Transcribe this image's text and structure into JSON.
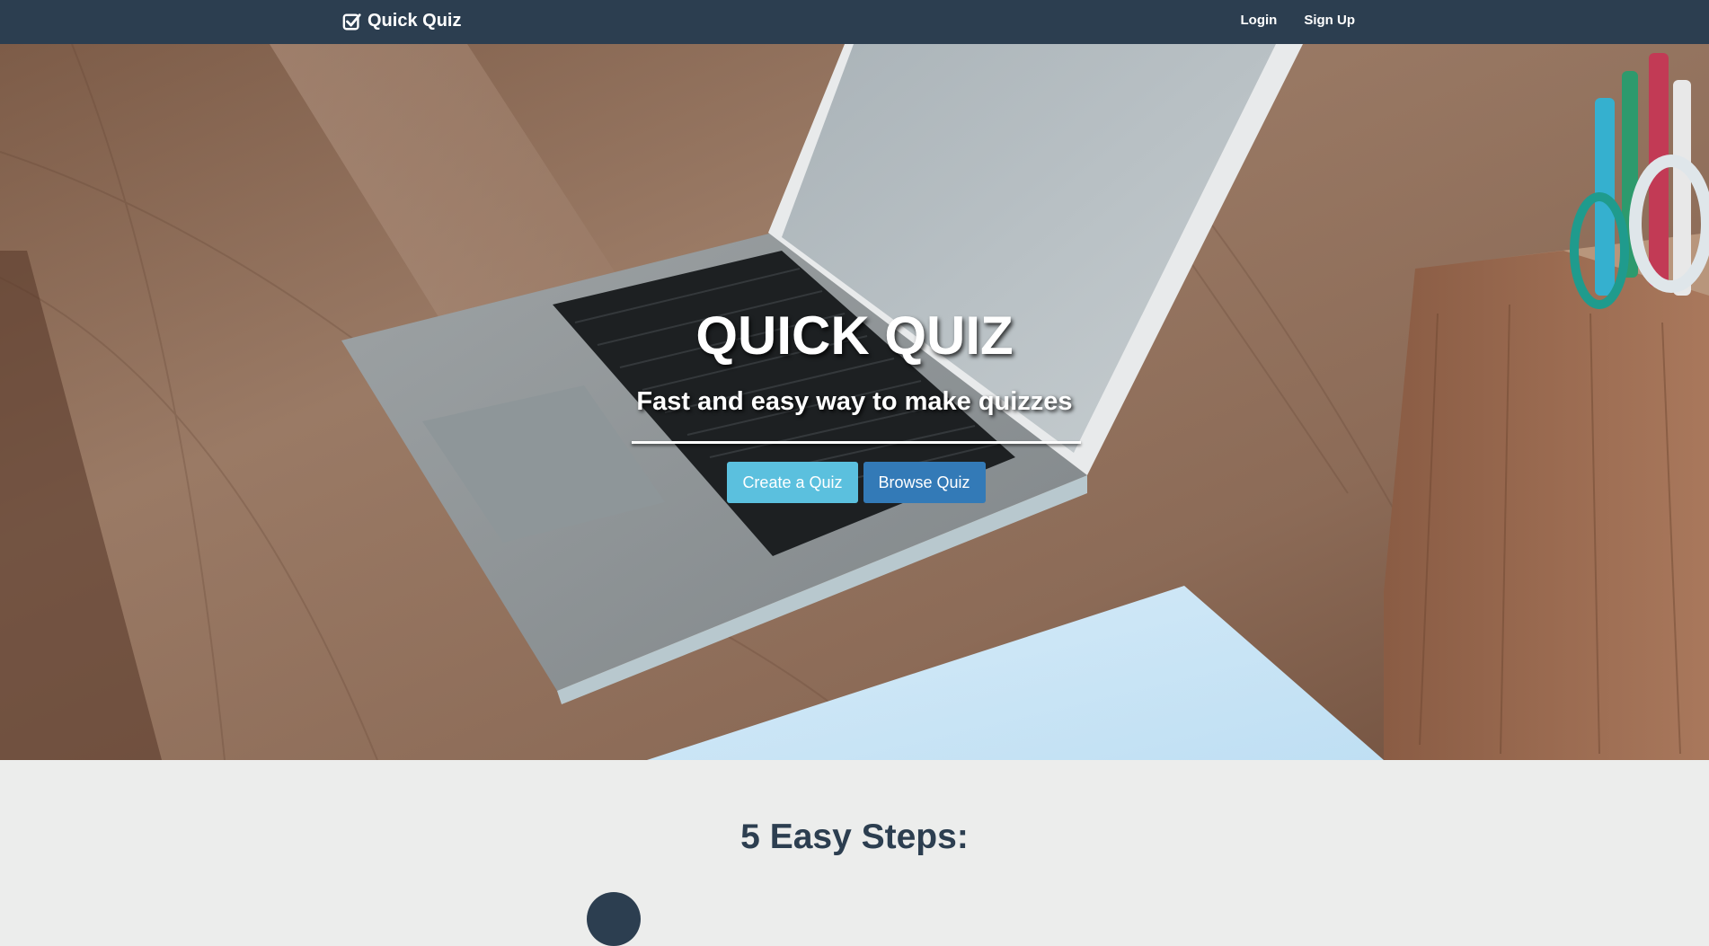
{
  "navbar": {
    "brand_label": "Quick Quiz",
    "brand_icon": "check-square-icon",
    "links": [
      {
        "label": "Login"
      },
      {
        "label": "Sign Up"
      }
    ]
  },
  "hero": {
    "title": "QUICK QUIZ",
    "subtitle": "Fast and easy way to make quizzes",
    "buttons": {
      "create_label": "Create a Quiz",
      "browse_label": "Browse Quiz"
    }
  },
  "steps": {
    "title": "5 Easy Steps:"
  },
  "colors": {
    "navbar_bg": "#2c3e50",
    "btn_info": "#5bc0de",
    "btn_primary": "#337ab7",
    "section_bg": "#ecedec",
    "heading": "#2c3e50"
  }
}
